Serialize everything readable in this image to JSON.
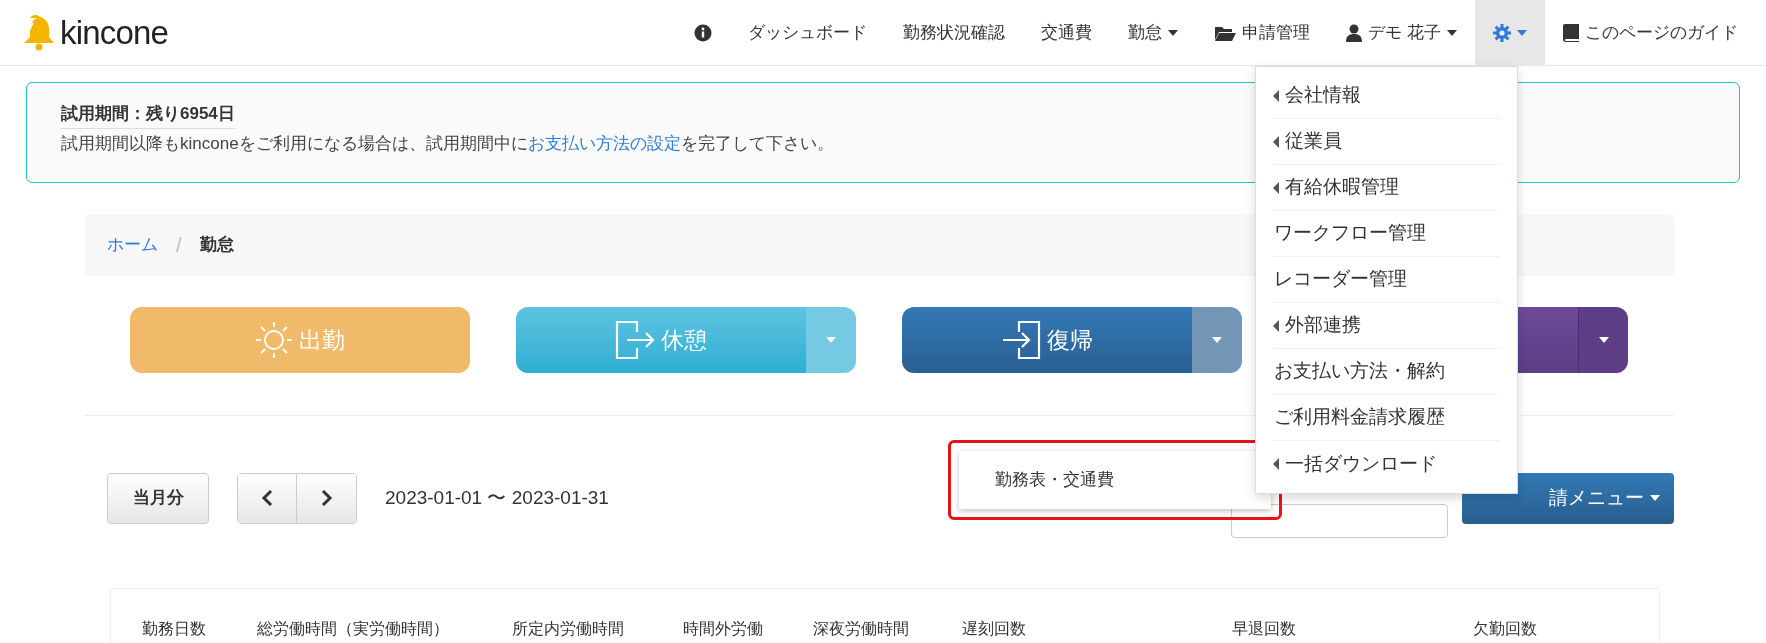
{
  "nav": {
    "logo": "kincone",
    "items": [
      {
        "kind": "info",
        "selected": false
      },
      {
        "kind": "link",
        "label": "ダッシュボード",
        "selected": false
      },
      {
        "kind": "link",
        "label": "勤務状況確認",
        "selected": false
      },
      {
        "kind": "link",
        "label": "交通費",
        "selected": false
      },
      {
        "kind": "menu",
        "label": "勤怠",
        "selected": false
      },
      {
        "kind": "folder",
        "label": "申請管理",
        "selected": false
      },
      {
        "kind": "user",
        "label": "デモ 花子",
        "selected": false
      },
      {
        "kind": "settings",
        "selected": true
      },
      {
        "kind": "guide",
        "label": "このページのガイド",
        "selected": false
      }
    ]
  },
  "settings_menu": [
    {
      "label": "会社情報",
      "has_submenu": true
    },
    {
      "label": "従業員",
      "has_submenu": true
    },
    {
      "label": "有給休暇管理",
      "has_submenu": true
    },
    {
      "label": "ワークフロー管理",
      "has_submenu": false
    },
    {
      "label": "レコーダー管理",
      "has_submenu": false
    },
    {
      "label": "外部連携",
      "has_submenu": true
    },
    {
      "label": "お支払い方法・解約",
      "has_submenu": false
    },
    {
      "label": "ご利用料金請求履歴",
      "has_submenu": false
    },
    {
      "label": "一括ダウンロード",
      "has_submenu": true
    }
  ],
  "alert": {
    "title": "試用期間：残り6954日",
    "before": "試用期間以降もkinconeをご利用になる場合は、試用期間中に",
    "link": "お支払い方法の設定",
    "after": "を完了して下さい。"
  },
  "breadcrumb": [
    {
      "label": "ホーム",
      "link": true
    },
    {
      "separator": "/",
      "label": "勤怠",
      "link": false
    }
  ],
  "punch_buttons": [
    {
      "kind": "clock_in",
      "label": "出勤",
      "split": false
    },
    {
      "kind": "break",
      "label": "休憩",
      "split": true
    },
    {
      "kind": "return",
      "label": "復帰",
      "split": true
    },
    {
      "kind": "clock_out",
      "split": true
    }
  ],
  "period": {
    "current_button": "当月分",
    "range": "2023-01-01 〜 2023-01-31"
  },
  "submenu_popup": {
    "item": "勤務表・交通費",
    "highlighted": true
  },
  "request_menu": "請メニュー",
  "summary_columns": [
    "勤務日数",
    "総労働時間（実労働時間）",
    "所定内労働時間",
    "時間外労働",
    "深夜労働時間",
    "遅刻回数",
    "早退回数",
    "欠勤回数"
  ]
}
